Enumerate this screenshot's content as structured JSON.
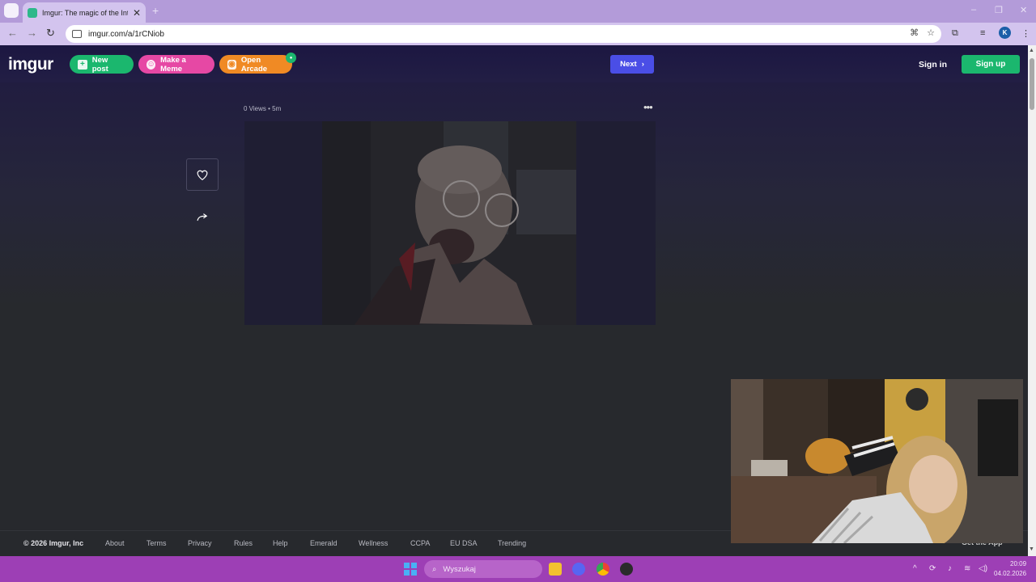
{
  "browser": {
    "tab_title": "Imgur: The magic of the Interne",
    "tab_close": "✕",
    "new_tab": "+",
    "url": "imgur.com/a/1rCNiob",
    "profile_initial": "K",
    "window_controls": [
      "–",
      "❐",
      "✕"
    ],
    "icons": [
      "back-icon",
      "forward-icon",
      "reload-icon",
      "site-info-icon",
      "translate-icon",
      "bookmark-star-icon",
      "extensions-icon",
      "reading-list-icon",
      "menu-icon"
    ]
  },
  "header": {
    "logo": "imgur",
    "new_post": "New post",
    "make_meme": "Make a Meme",
    "open_arcade": "Open Arcade",
    "next": "Next",
    "sign_in": "Sign in",
    "sign_up": "Sign up"
  },
  "post": {
    "meta": "0 Views • 5m",
    "more": "•••"
  },
  "footer": {
    "copyright": "© 2026 Imgur, Inc",
    "links": [
      "About",
      "Terms",
      "Privacy",
      "Rules",
      "Help",
      "Emerald",
      "Wellness",
      "CCPA",
      "EU DSA",
      "Trending"
    ],
    "get_app": "Get the App"
  },
  "taskbar": {
    "search_placeholder": "Wyszukaj",
    "time": "20:09",
    "date": "04.02.2026"
  },
  "colors": {
    "header_bg": "#1c1742",
    "new_post_green": "#1bb76e",
    "meme_pink": "#e648a4",
    "arcade_orange": "#f08a24",
    "next_blue": "#4a4ee6",
    "taskbar_purple": "#9d3fb5",
    "browser_purple": "#b39bd9"
  }
}
